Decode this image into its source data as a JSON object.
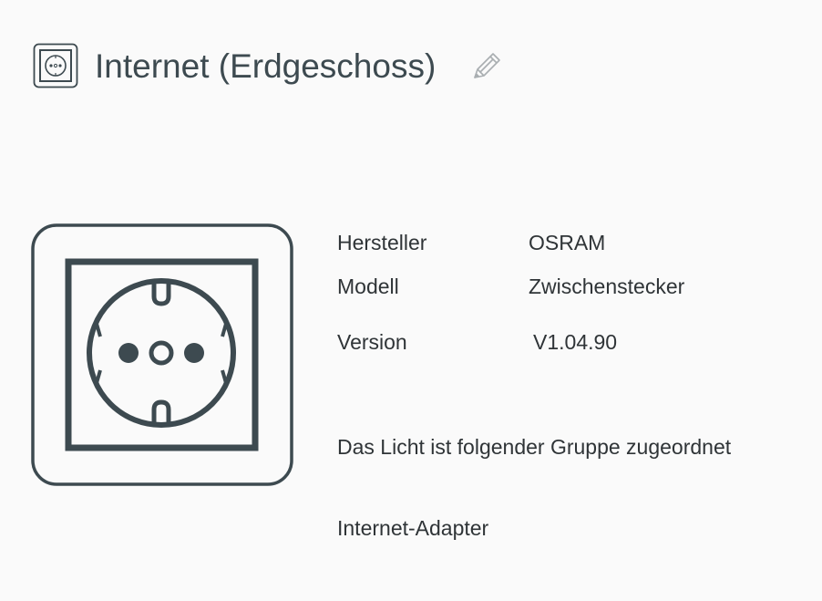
{
  "header": {
    "title": "Internet (Erdgeschoss)",
    "device_icon": "power-socket-icon",
    "edit_icon": "pencil-icon"
  },
  "device": {
    "image_icon": "power-socket-icon",
    "info": [
      {
        "label": "Hersteller",
        "value": "OSRAM"
      },
      {
        "label": "Modell",
        "value": "Zwischenstecker"
      },
      {
        "label": "Version",
        "value": "V1.04.90"
      }
    ]
  },
  "group": {
    "heading": "Das Licht ist folgender Gruppe zugeordnet",
    "name": "Internet-Adapter"
  },
  "colors": {
    "background": "#fafafa",
    "icon_stroke": "#3d4a50",
    "text": "#2f3437"
  }
}
